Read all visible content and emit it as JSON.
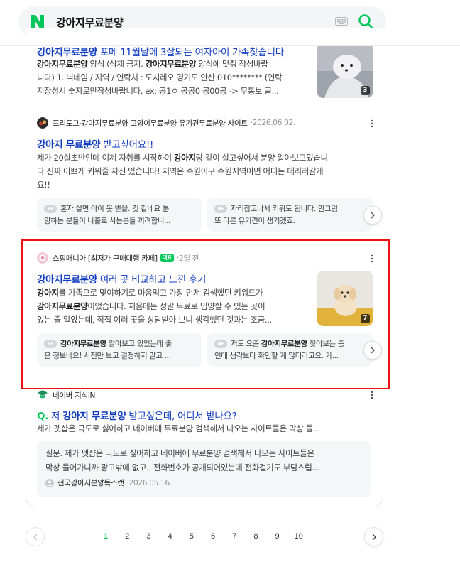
{
  "search": {
    "query": "강아지무료분양"
  },
  "results": {
    "top": {
      "title": "강아지무료분양 포메 11월날에 3살되는 여자아이 가족찾습니다",
      "desc_line1_bold": "강아지무료분양",
      "desc_line1_rest": " 양식 (삭제 금지. 강아지무료분양 양식에 맞춰 작성바랍",
      "desc_line2": "니다) 1. 닉네임 / 지역 / 연락처 : 도치레오 경기도 안산 010******** (연락",
      "desc_line3": "저장성시 숫자로만작성바랍니다. ex: 공1ㅇ 공공0 공00공 -> 무통보 글...",
      "thumb_count": "3"
    },
    "second": {
      "source": "프리도그-강아지무료분양 고양이무료분양 유기견무료분양 사이트",
      "date": "2026.06.02.",
      "title": "강아지 무료분양 받고싶어요!!",
      "desc_line1": "제가 20살초반인데 이제 자취를 시작하여 강아지랑 같이 살고싶어서 분양 알아보고있습니",
      "desc_line2": "다 진짜 이쁘게 키워줄 자신 있습니다! 지역은 수원이구 수원지역이면 어디든 데리러갈게",
      "desc_line3": "요!!",
      "badge": "RE",
      "reply1_line1": "혼자 살면 아이 못 받을. 것 같네요 분",
      "reply1_line2": "양하는 분들이 나홀로 사는분들 꺼려합니...",
      "reply2_line1": "자리잡고나서 키워도 됩니다. 안그럼",
      "reply2_line2": "또 다른 유기견이 생기겠죠."
    },
    "third": {
      "source": "쇼핑매니아 [최저가 구매대행 카페]",
      "cafe_badge": "대표",
      "date": "2일 전",
      "title": "강아지무료분양 여러 곳 비교하고 느낀 후기",
      "desc_line1": "강아지를 가족으로 맞이하기로 마음먹고 가장 먼저 검색했던 키워드가",
      "desc_line2": "강아지무료분양이었습니다. 처음에는 정말 무료로 입양할 수 있는 곳이",
      "desc_line3": "있는 줄 알았는데, 직접 여러 곳을 상담받아 보니 생각했던 것과는 조금...",
      "thumb_count": "7",
      "badge": "RE",
      "reply1_line1": "강아지무료분양 알아보고 있었는데 좋",
      "reply1_line2": "은 정보네요! 사진만 보고 결정하지 말고 ...",
      "reply2_line1": "저도 요즘 강아지무료분양 찾아보는 중",
      "reply2_line2": "인데 생각보다 확인할 게 많더라고요. 가..."
    },
    "kin": {
      "source": "네이버 지식iN",
      "q_mark": "Q.",
      "title": "저 강아지 무료분양 받고싶은데, 어디서 받나요?",
      "desc": "제가 펫샵은 극도로 싫어하고 네이버에 무료분양 검색해서 나오는 사이트들은 막상 들...",
      "answer_line1": "질문. 제가 펫샵은 극도로 싫어하고 네이버에 무료분양 검색해서 나오는 사이트들은",
      "answer_line2": "막상 들어가니까 광고밖에 없고.. 전화번호가 공개되어있는데 전화걸기도 부담스럽...",
      "answer_author": "전국강아지분양독스캣",
      "answer_date": "2026.05.16."
    }
  },
  "pagination": {
    "pages": [
      "1",
      "2",
      "3",
      "4",
      "5",
      "6",
      "7",
      "8",
      "9",
      "10"
    ],
    "current": "1"
  },
  "colors": {
    "brand_green": "#03c75a",
    "link_blue": "#0f3bbf",
    "highlight_red": "#ee1111"
  }
}
